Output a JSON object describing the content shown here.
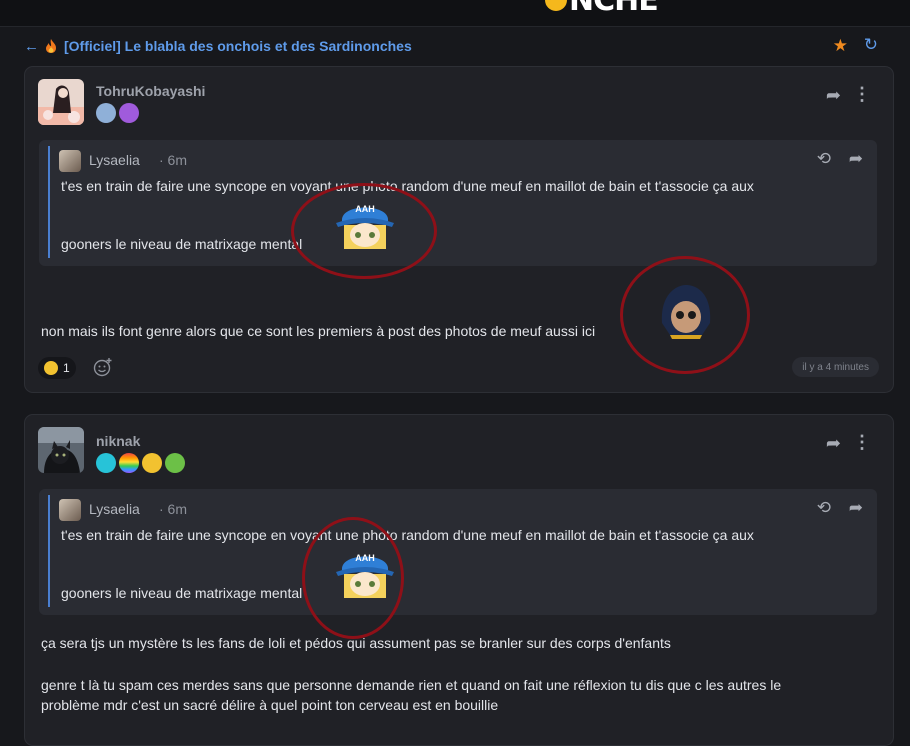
{
  "header": {
    "logo_text": "NCHE"
  },
  "topic": {
    "title": "[Officiel] Le blabla des onchois et des Sardinonches",
    "back_icon": "arrow-left-icon",
    "favorite_icon": "star-icon",
    "refresh_icon": "refresh-icon"
  },
  "posts": [
    {
      "author": "TohruKobayashi",
      "quote": {
        "author": "Lysaelia",
        "time": "· 6m",
        "line1": "t'es en train de faire une syncope en voyant une photo random d'une meuf en maillot de bain et t'associe ça aux",
        "line2": "gooners le niveau de matrixage mental"
      },
      "body": "non mais ils font genre alors que ce sont les premiers à post des photos de meuf aussi ici",
      "reaction_count": "1",
      "timestamp": "il y a 4 minutes"
    },
    {
      "author": "niknak",
      "quote": {
        "author": "Lysaelia",
        "time": "· 6m",
        "line1": "t'es en train de faire une syncope en voyant une photo random d'une meuf en maillot de bain et t'associe ça aux",
        "line2": "gooners le niveau de matrixage mental"
      },
      "body1": "ça sera tjs un mystère ts les fans de loli et pédos qui assument pas se branler sur des corps d'enfants",
      "body2": "genre t là tu spam ces merdes sans que personne demande rien et quand on fait une réflexion tu dis que c les autres le",
      "body3": "problème mdr c'est un sacré délire à quel point ton cerveau est en bouillie"
    }
  ],
  "sticker_hat_text": "AAH",
  "colors": {
    "accent": "#5f9bea",
    "star": "#f08a1f",
    "circle": "#8e1018",
    "card": "#202126",
    "quote": "#2a2c33"
  }
}
